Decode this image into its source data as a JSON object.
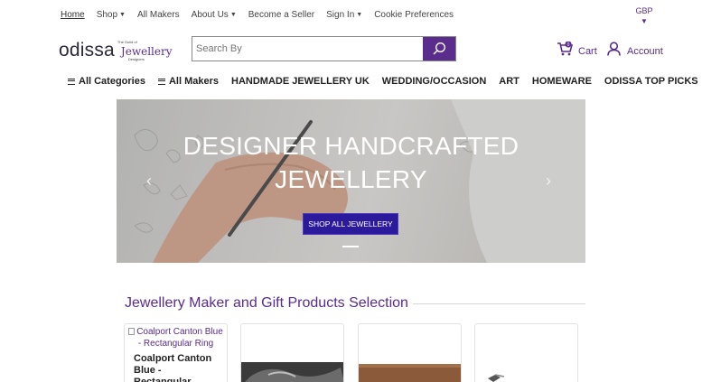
{
  "topnav": {
    "home": "Home",
    "shop": "Shop",
    "all_makers": "All Makers",
    "about_us": "About Us",
    "become_seller": "Become a Seller",
    "sign_in": "Sign In",
    "cookie": "Cookie Preferences",
    "currency": "GBP"
  },
  "header": {
    "logo_text": "odissa",
    "guild_small": "The Guild of",
    "guild_main": "Jewellery",
    "guild_sub": "Designers",
    "search_placeholder": "Search By",
    "cart_label": "Cart",
    "cart_count": "0",
    "account_label": "Account"
  },
  "categories": {
    "all_categories": "All Categories",
    "all_makers": "All Makers",
    "items": [
      "HANDMADE JEWELLERY UK",
      "WEDDING/OCCASION",
      "ART",
      "HOMEWARE",
      "ODISSA TOP PICKS"
    ]
  },
  "hero": {
    "title_line1": "DESIGNER HANDCRAFTED",
    "title_line2": "JEWELLERY",
    "cta": "SHOP ALL JEWELLERY",
    "prev": "‹",
    "next": "›"
  },
  "section": {
    "title": "Jewellery Maker and Gift Products Selection"
  },
  "products": [
    {
      "image_alt": "Coalport Canton Blue - Rectangular Ring",
      "name": "Coalport Canton Blue - Rectangular"
    }
  ],
  "colors": {
    "brand_purple": "#5a2c8c",
    "cta_blue": "#2b1b9c"
  },
  "icons": [
    "chevron-down-icon",
    "search-icon",
    "cart-icon",
    "user-icon",
    "menu-icon",
    "arrow-left-icon",
    "arrow-right-icon"
  ]
}
